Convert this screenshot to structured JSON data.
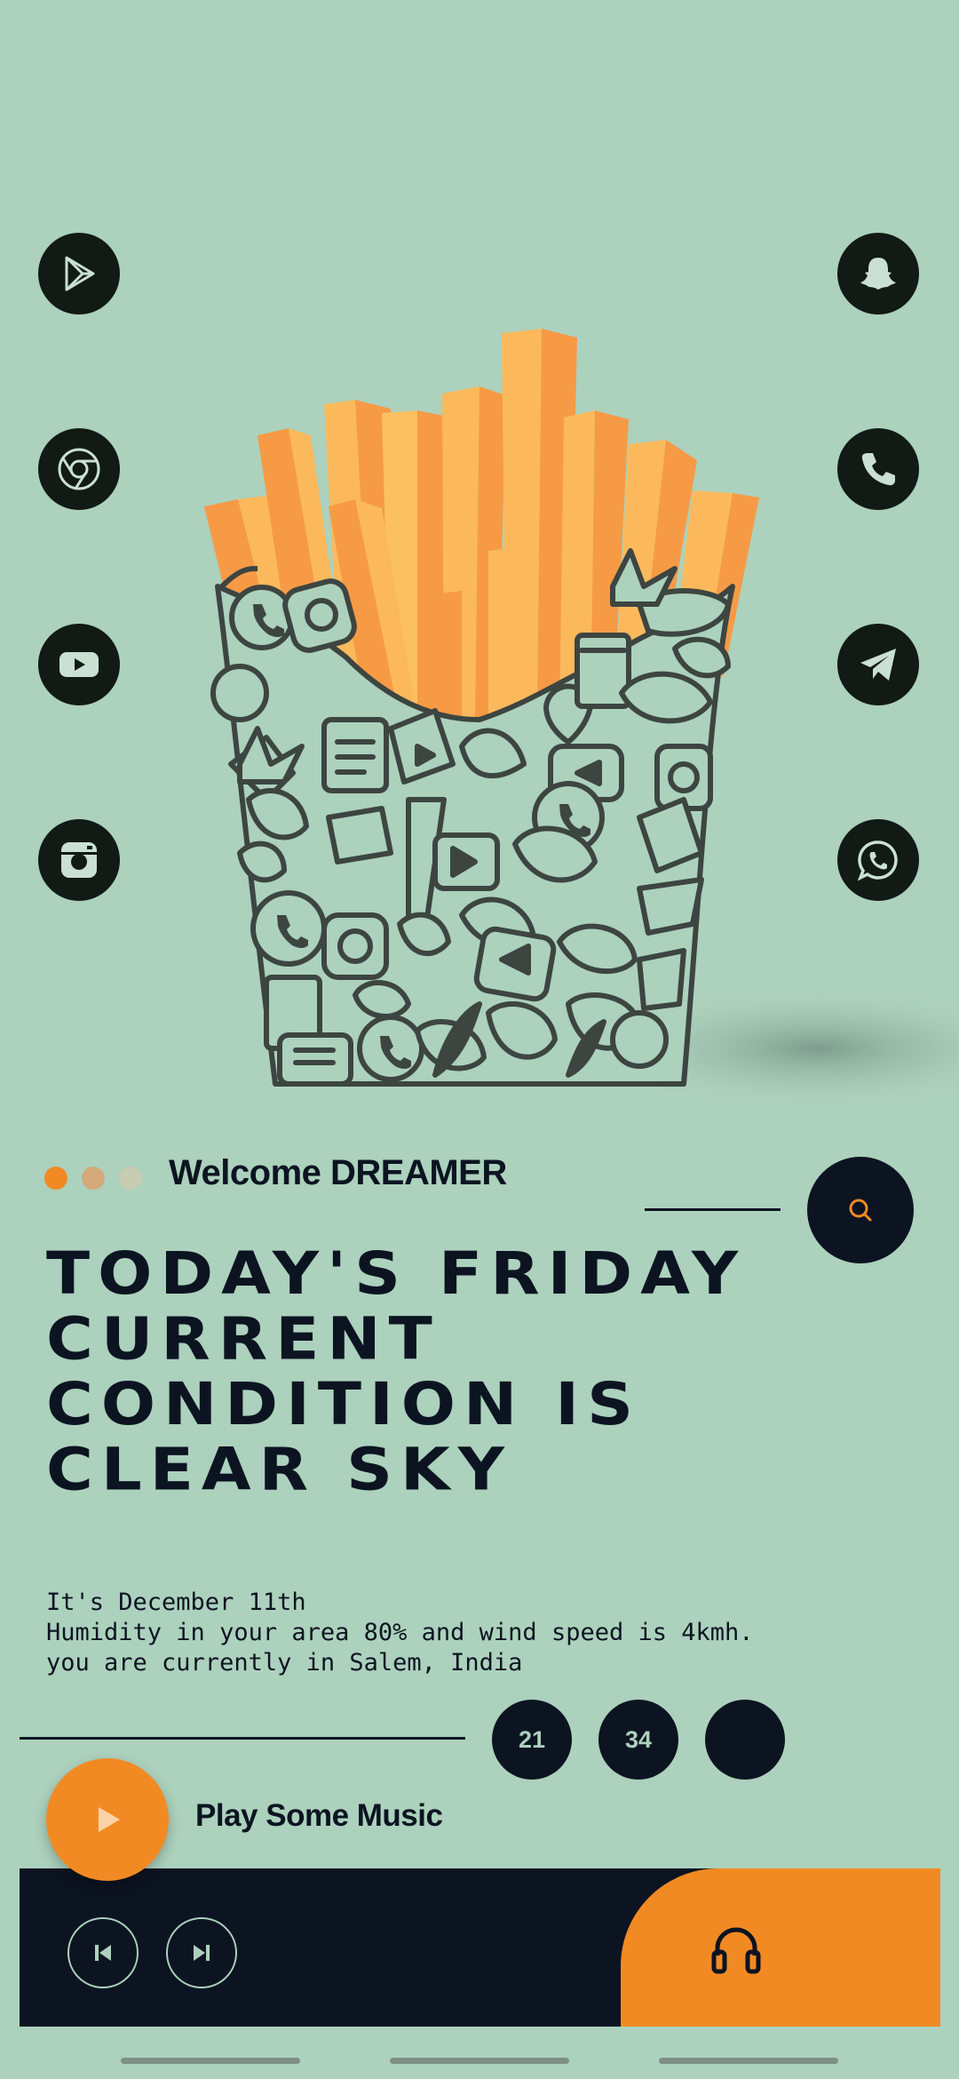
{
  "left_apps": [
    {
      "name": "google-play-icon"
    },
    {
      "name": "chrome-icon"
    },
    {
      "name": "youtube-icon"
    },
    {
      "name": "instagram-icon"
    }
  ],
  "right_apps": [
    {
      "name": "snapchat-icon"
    },
    {
      "name": "phone-icon"
    },
    {
      "name": "telegram-icon"
    },
    {
      "name": "whatsapp-icon"
    }
  ],
  "welcome": {
    "text": "Welcome DREAMER",
    "dots": [
      "#f28a24",
      "#d4aa7a",
      "#c8ccb0"
    ]
  },
  "search": {
    "icon": "search-icon"
  },
  "headline": {
    "line1": "TODAY'S FRIDAY",
    "line2": "CURRENT",
    "line3": "CONDITION IS",
    "line4": "CLEAR SKY"
  },
  "info": {
    "date": "It's December 11th",
    "weather": "Humidity in your area 80% and wind speed is 4kmh.",
    "location": "you are currently in Salem, India"
  },
  "stats": {
    "first": "21",
    "second": "34",
    "third": ""
  },
  "music": {
    "label": "Play Some Music"
  },
  "colors": {
    "background": "#acd1bd",
    "dark": "#0c1421",
    "accent": "#f28a24"
  }
}
